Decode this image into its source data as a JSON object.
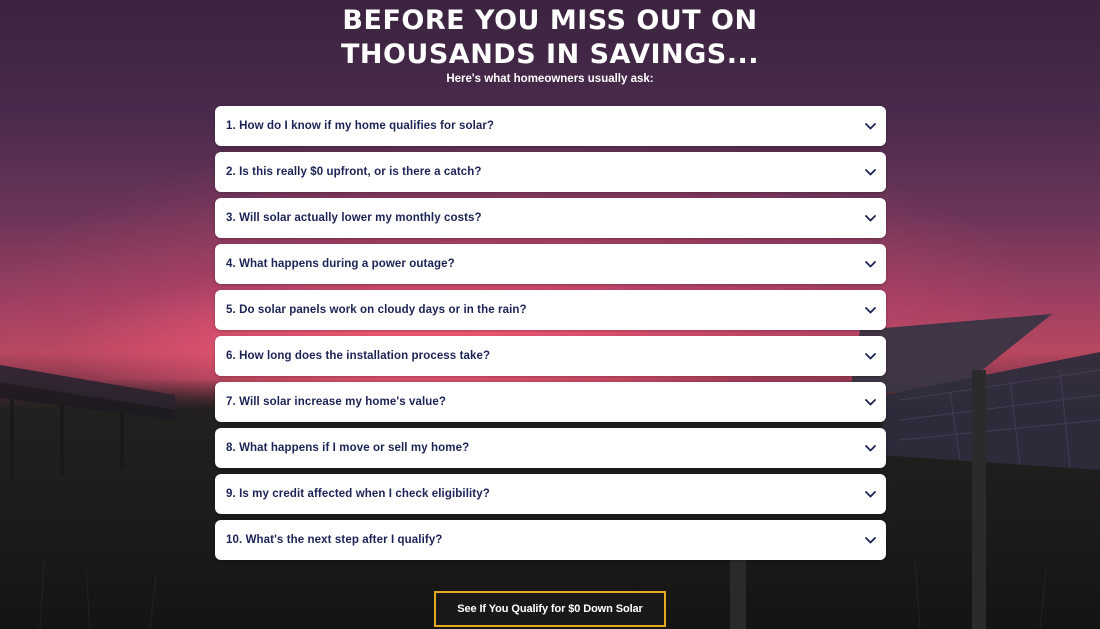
{
  "hero": {
    "title_line1": "BEFORE YOU MISS OUT ON",
    "title_line2": "THOUSANDS IN SAVINGS...",
    "subtitle": "Here's what homeowners usually ask:"
  },
  "faq": {
    "items": [
      {
        "question": "1. How do I know if my home qualifies for solar?"
      },
      {
        "question": "2. Is this really $0 upfront, or is there a catch?"
      },
      {
        "question": "3. Will solar actually lower my monthly costs?"
      },
      {
        "question": "4. What happens during a power outage?"
      },
      {
        "question": "5. Do solar panels work on cloudy days or in the rain?"
      },
      {
        "question": "6. How long does the installation process take?"
      },
      {
        "question": "7. Will solar increase my home's value?"
      },
      {
        "question": "8. What happens if I move or sell my home?"
      },
      {
        "question": "9. Is my credit affected when I check eligibility?"
      },
      {
        "question": "10. What's the next step after I qualify?"
      }
    ],
    "expand_icon": "chevron-down-icon"
  },
  "cta": {
    "label": "See If You Qualify for $0 Down Solar"
  },
  "colors": {
    "question_text": "#1c2356",
    "cta_border": "#e6a820",
    "card_bg": "#ffffff"
  }
}
